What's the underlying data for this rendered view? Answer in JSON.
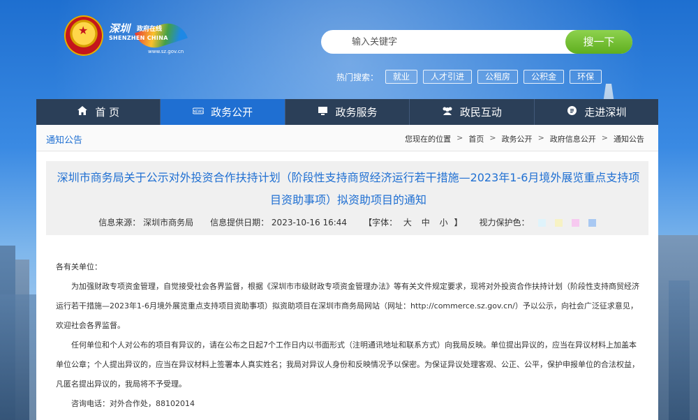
{
  "header": {
    "logo_cn": "深圳",
    "logo_cn2": "政府在线",
    "logo_en": "SHENZHEN CHINA",
    "logo_url": "www.sz.gov.cn"
  },
  "search": {
    "placeholder": "输入关键字",
    "button": "搜一下"
  },
  "hot_search": {
    "label": "热门搜索：",
    "tags": [
      "就业",
      "人才引进",
      "公租房",
      "公积金",
      "环保"
    ]
  },
  "nav": {
    "items": [
      {
        "label": "首 页",
        "icon": "home-icon"
      },
      {
        "label": "政务公开",
        "icon": "news-icon"
      },
      {
        "label": "政务服务",
        "icon": "monitor-icon"
      },
      {
        "label": "政民互动",
        "icon": "people-icon"
      },
      {
        "label": "走进深圳",
        "icon": "info-icon"
      }
    ],
    "active_index": 1
  },
  "section": {
    "title": "通知公告"
  },
  "breadcrumb": {
    "prefix": "您现在的位置",
    "items": [
      "首页",
      "政务公开",
      "政府信息公开",
      "通知公告"
    ],
    "separator": ">"
  },
  "article": {
    "title": "深圳市商务局关于公示对外投资合作扶持计划（阶段性支持商贸经济运行若干措施—2023年1-6月境外展览重点支持项目资助事项）拟资助项目的通知",
    "source_label": "信息来源：",
    "source": "深圳市商务局",
    "date_label": "信息提供日期：",
    "date": "2023-10-16 16:44",
    "font_label": "【字体：",
    "font_sizes": [
      "大",
      "中",
      "小"
    ],
    "font_close": "】",
    "vision_label": "视力保护色：",
    "vision_colors": [
      "#dff3fb",
      "#f7f2c4",
      "#f7c9f0",
      "#a8c8f2"
    ],
    "salutation": "各有关单位：",
    "paragraphs": [
      "为加强财政专项资金管理，自觉接受社会各界监督，根据《深圳市市级财政专项资金管理办法》等有关文件规定要求，现将对外投资合作扶持计划（阶段性支持商贸经济运行若干措施—2023年1-6月境外展览重点支持项目资助事项）拟资助项目在深圳市商务局网站（网址：http://commerce.sz.gov.cn/）予以公示，向社会广泛征求意见，欢迎社会各界监督。",
      "任何单位和个人对公布的项目有异议的，请在公布之日起7个工作日内以书面形式（注明通讯地址和联系方式）向我局反映。单位提出异议的，应当在异议材料上加盖本单位公章；个人提出异议的，应当在异议材料上签署本人真实姓名；我局对异议人身份和反映情况予以保密。为保证异议处理客观、公正、公平，保护申报单位的合法权益，凡匿名提出异议的，我局将不予受理。",
      "咨询电话：对外合作处，88102014"
    ]
  }
}
